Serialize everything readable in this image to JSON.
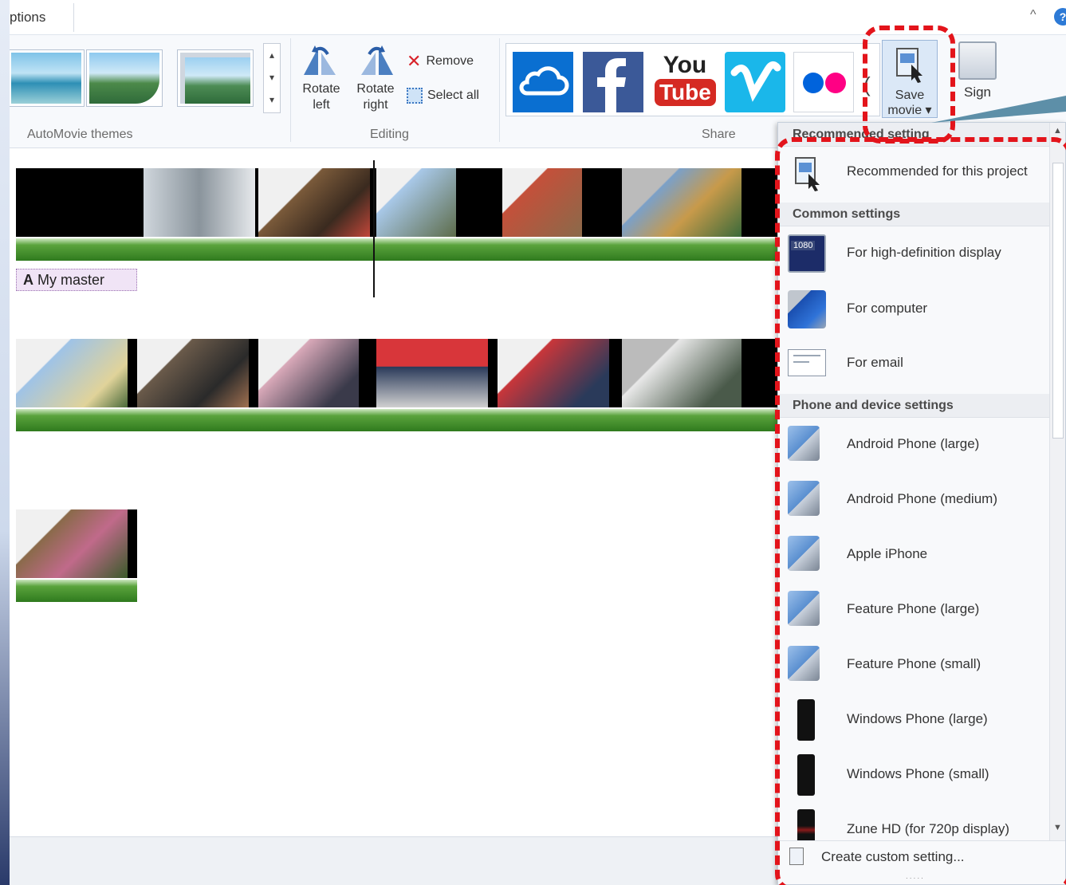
{
  "menubar": {
    "tab_label": "ptions",
    "caret": "^",
    "help": "?"
  },
  "ribbon": {
    "groups": {
      "themes": "AutoMovie themes",
      "editing": "Editing",
      "share": "Share"
    },
    "rotate_left": {
      "line1": "Rotate",
      "line2": "left"
    },
    "rotate_right": {
      "line1": "Rotate",
      "line2": "right"
    },
    "remove": "Remove",
    "select_all": "Select all",
    "save_movie": {
      "line1": "Save",
      "line2": "movie ▾"
    },
    "sign_in": "Sign",
    "youtube": {
      "line1": "You",
      "line2": "Tube"
    }
  },
  "timeline": {
    "caption": "My master",
    "caption_glyph": "A"
  },
  "dropdown": {
    "headers": [
      "Recommended setting",
      "Common settings",
      "Phone and device settings"
    ],
    "recommended": [
      "Recommended for this project"
    ],
    "common": [
      "For high-definition display",
      "For computer",
      "For email"
    ],
    "devices": [
      "Android Phone (large)",
      "Android Phone (medium)",
      "Apple iPhone",
      "Feature Phone (large)",
      "Feature Phone (small)",
      "Windows Phone (large)",
      "Windows Phone (small)",
      "Zune HD (for 720p display)"
    ],
    "hd_badge": "1080",
    "footer": "Create custom setting...",
    "grip": "....."
  },
  "colors": {
    "annotation": "#e3141b",
    "accent": "#2d7ad6",
    "wave": "#3f8f26"
  }
}
